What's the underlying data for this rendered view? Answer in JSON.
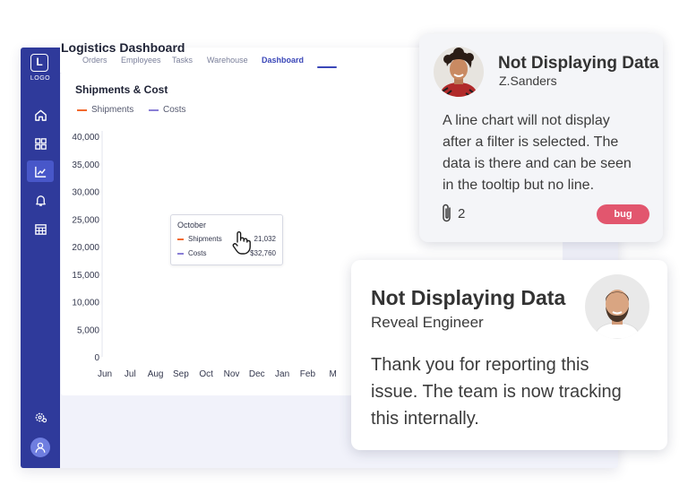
{
  "sidebar": {
    "logo_letter": "L",
    "logo_text": "LOGO",
    "items": [
      {
        "icon": "home-icon"
      },
      {
        "icon": "grid-icon"
      },
      {
        "icon": "chart-line-icon",
        "active": true
      },
      {
        "icon": "bell-icon"
      },
      {
        "icon": "calendar-icon"
      }
    ],
    "bottom": [
      {
        "icon": "settings-icon"
      },
      {
        "icon": "user-icon"
      }
    ],
    "colors": {
      "background": "#2f3a9b",
      "active": "#4857c9"
    }
  },
  "topnav": {
    "tabs": [
      {
        "label": "Orders"
      },
      {
        "label": "Employees"
      },
      {
        "label": "Tasks"
      },
      {
        "label": "Warehouse"
      },
      {
        "label": "Dashboard",
        "active": true
      }
    ]
  },
  "page": {
    "title": "Logistics Dashboard"
  },
  "chart_data": {
    "type": "line",
    "title": "Shipments & Cost",
    "series": [
      {
        "name": "Shipments",
        "color": "#f26a2e",
        "values": []
      },
      {
        "name": "Costs",
        "color": "#8a7fd6",
        "values": []
      }
    ],
    "categories": [
      "Jun",
      "Jul",
      "Aug",
      "Sep",
      "Oct",
      "Nov",
      "Dec",
      "Jan",
      "Feb",
      "M"
    ],
    "yticks": [
      "0",
      "5,000",
      "10,000",
      "15,000",
      "20,000",
      "25,000",
      "30,000",
      "35,000",
      "40,000"
    ],
    "ylim": [
      0,
      40000
    ],
    "grid": false,
    "legend": "top-left",
    "tooltip": {
      "title": "October",
      "rows": [
        {
          "label": "Shipments",
          "value": "21,032",
          "color": "#f26a2e"
        },
        {
          "label": "Costs",
          "value": "$32,760",
          "color": "#8a7fd6"
        }
      ]
    }
  },
  "issue_card": {
    "title": "Not Displaying Data",
    "author": "Z.Sanders",
    "body": [
      "A line chart will not display",
      "after a filter is selected. The",
      "data is there and can be seen",
      "in the tooltip but no line."
    ],
    "attachments": "2",
    "badge": "bug",
    "badge_color": "#e2566e"
  },
  "reply_card": {
    "title": "Not Displaying Data",
    "role": "Reveal Engineer",
    "body": [
      "Thank you for reporting this",
      "issue. The team is now tracking",
      "this internally."
    ]
  }
}
